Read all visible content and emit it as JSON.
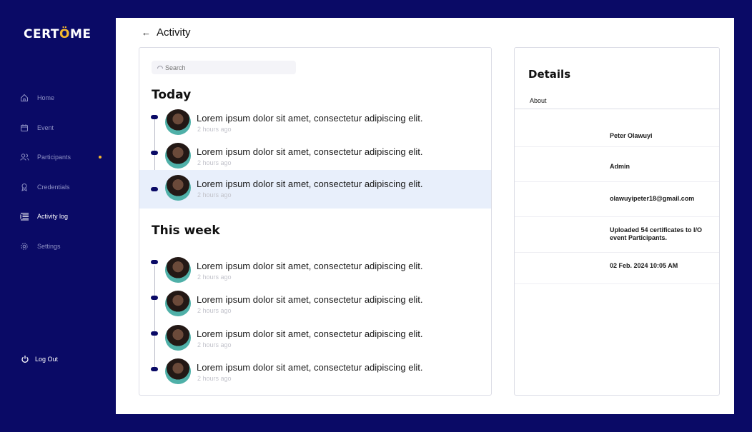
{
  "brand": {
    "name_a": "CERT",
    "name_crown": "Ö",
    "name_b": "ME"
  },
  "sidebar": {
    "items": [
      {
        "label": "Home",
        "icon": "home-icon"
      },
      {
        "label": "Event",
        "icon": "calendar-icon"
      },
      {
        "label": "Participants",
        "icon": "users-icon"
      },
      {
        "label": "Credentials",
        "icon": "badge-icon"
      },
      {
        "label": "Activity log",
        "icon": "list-icon"
      },
      {
        "label": "Settings",
        "icon": "gear-icon"
      }
    ],
    "active": "Activity log",
    "logout_label": "Log Out"
  },
  "page": {
    "title": "Activity"
  },
  "search": {
    "placeholder": "Search"
  },
  "sections": {
    "today": "Today",
    "week": "This week"
  },
  "activities": {
    "today": [
      {
        "message": "Lorem ipsum dolor sit amet, consectetur adipiscing elit.",
        "time": "2 hours ago"
      },
      {
        "message": "Lorem ipsum dolor sit amet, consectetur adipiscing elit.",
        "time": "2 hours ago"
      },
      {
        "message": "Lorem ipsum dolor sit amet, consectetur adipiscing elit.",
        "time": "2 hours ago"
      }
    ],
    "week": [
      {
        "message": "Lorem ipsum dolor sit amet, consectetur adipiscing elit.",
        "time": "2 hours ago"
      },
      {
        "message": "Lorem ipsum dolor sit amet, consectetur adipiscing elit.",
        "time": "2 hours ago"
      },
      {
        "message": "Lorem ipsum dolor sit amet, consectetur adipiscing elit.",
        "time": "2 hours ago"
      },
      {
        "message": "Lorem ipsum dolor sit amet, consectetur adipiscing elit.",
        "time": "2 hours ago"
      }
    ]
  },
  "details": {
    "title": "Details",
    "about_label": "About",
    "name": "Peter Olawuyi",
    "role": "Admin",
    "email": "olawuyipeter18@gmail.com",
    "action": "Uploaded 54 certificates to I/O event Participants.",
    "date": "02 Feb. 2024 10:05 AM"
  },
  "colors": {
    "sidebar_bg": "#0a0a66",
    "accent": "#f5b82e",
    "highlight": "#e8effb"
  }
}
